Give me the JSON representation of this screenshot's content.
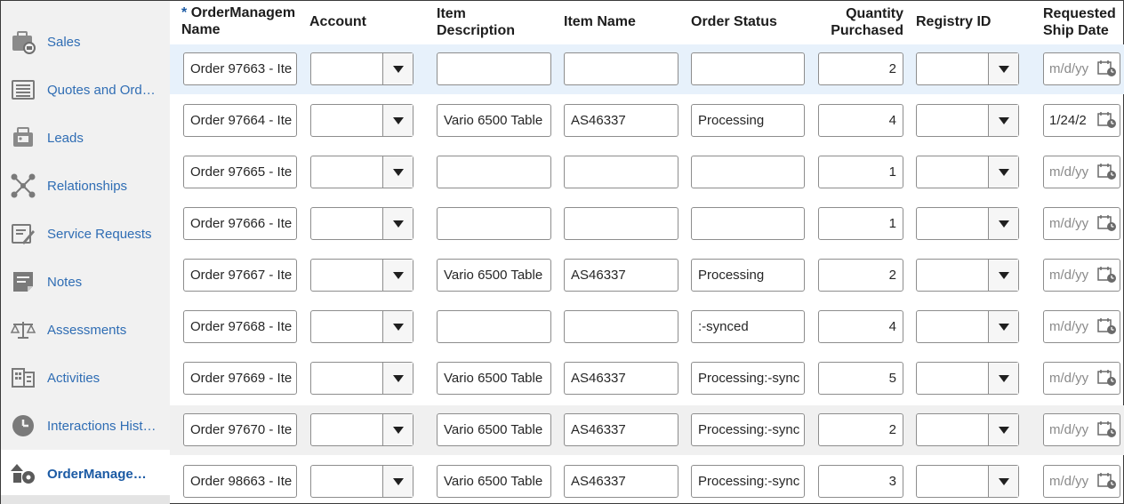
{
  "sidebar": {
    "items": [
      {
        "label": "Sales",
        "icon": "sales-briefcase-icon"
      },
      {
        "label": "Quotes and Ord…",
        "icon": "quotes-list-icon"
      },
      {
        "label": "Leads",
        "icon": "leads-card-icon"
      },
      {
        "label": "Relationships",
        "icon": "relationships-network-icon"
      },
      {
        "label": "Service Requests",
        "icon": "service-request-icon"
      },
      {
        "label": "Notes",
        "icon": "notes-icon"
      },
      {
        "label": "Assessments",
        "icon": "assessment-scale-icon"
      },
      {
        "label": "Activities",
        "icon": "activities-calendar-icon"
      },
      {
        "label": "Interactions Hist…",
        "icon": "clock-icon"
      },
      {
        "label": "OrderManage…",
        "icon": "order-management-icon",
        "active": true
      }
    ]
  },
  "table": {
    "columns": {
      "order_name": {
        "required_mark": "*",
        "line1": "OrderManagem",
        "line2": "Name"
      },
      "account": {
        "line1": "Account"
      },
      "item_description": {
        "line1": "Item",
        "line2": "Description"
      },
      "item_name": {
        "line1": "Item Name"
      },
      "order_status": {
        "line1": "Order Status"
      },
      "quantity": {
        "line1": "Quantity",
        "line2": "Purchased"
      },
      "registry_id": {
        "line1": "Registry ID"
      },
      "ship_date": {
        "line1": "Requested",
        "line2": "Ship Date"
      }
    },
    "rows": [
      {
        "order_name": "Order 97663 - Ite",
        "account": "",
        "item_description": "",
        "item_name": "",
        "order_status": "",
        "quantity": "2",
        "registry_id": "",
        "ship_date": "m/d/yy",
        "ship_date_is_placeholder": true
      },
      {
        "order_name": "Order 97664 - Ite",
        "account": "",
        "item_description": "Vario 6500 Table",
        "item_name": "AS46337",
        "order_status": "Processing",
        "quantity": "4",
        "registry_id": "",
        "ship_date": "1/24/2",
        "ship_date_is_placeholder": false
      },
      {
        "order_name": "Order 97665 - Ite",
        "account": "",
        "item_description": "",
        "item_name": "",
        "order_status": "",
        "quantity": "1",
        "registry_id": "",
        "ship_date": "m/d/yy",
        "ship_date_is_placeholder": true
      },
      {
        "order_name": "Order 97666 - Ite",
        "account": "",
        "item_description": "",
        "item_name": "",
        "order_status": "",
        "quantity": "1",
        "registry_id": "",
        "ship_date": "m/d/yy",
        "ship_date_is_placeholder": true
      },
      {
        "order_name": "Order 97667 - Ite",
        "account": "",
        "item_description": "Vario 6500 Table",
        "item_name": "AS46337",
        "order_status": "Processing",
        "quantity": "2",
        "registry_id": "",
        "ship_date": "m/d/yy",
        "ship_date_is_placeholder": true
      },
      {
        "order_name": "Order 97668 - Ite",
        "account": "",
        "item_description": "",
        "item_name": "",
        "order_status": ":-synced",
        "quantity": "4",
        "registry_id": "",
        "ship_date": "m/d/yy",
        "ship_date_is_placeholder": true
      },
      {
        "order_name": "Order 97669 - Ite",
        "account": "",
        "item_description": "Vario 6500 Table",
        "item_name": "AS46337",
        "order_status": "Processing:-sync",
        "quantity": "5",
        "registry_id": "",
        "ship_date": "m/d/yy",
        "ship_date_is_placeholder": true
      },
      {
        "order_name": "Order 97670 - Ite",
        "account": "",
        "item_description": "Vario 6500 Table",
        "item_name": "AS46337",
        "order_status": "Processing:-sync",
        "quantity": "2",
        "registry_id": "",
        "ship_date": "m/d/yy",
        "ship_date_is_placeholder": true
      },
      {
        "order_name": "Order 98663 - Ite",
        "account": "",
        "item_description": "Vario 6500 Table",
        "item_name": "AS46337",
        "order_status": "Processing:-sync",
        "quantity": "3",
        "registry_id": "",
        "ship_date": "m/d/yy",
        "ship_date_is_placeholder": true
      }
    ]
  },
  "colors": {
    "link": "#2f6db4",
    "selected_row": "#e7f1fb",
    "sidebar_bg": "#f1f1f1"
  }
}
